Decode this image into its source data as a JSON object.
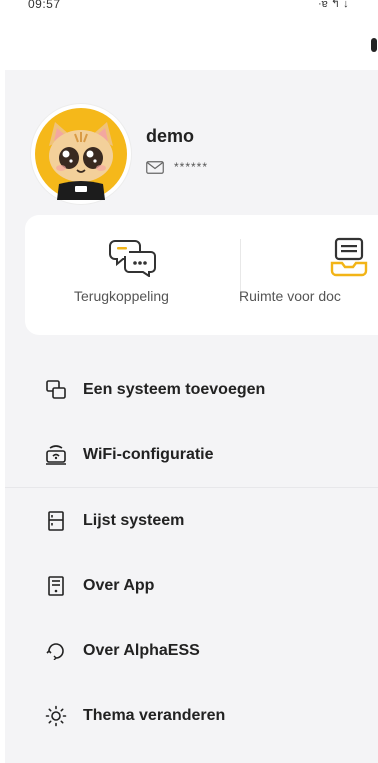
{
  "status_bar": {
    "time": "09:57",
    "icons": "·ɐ ↰ ↓"
  },
  "profile": {
    "username": "demo",
    "email_masked": "******",
    "avatar_icon": "cartoon-cat-avatar-icon",
    "email_icon": "envelope-icon"
  },
  "quick_actions": [
    {
      "label": "Terugkoppeling",
      "icon": "feedback-chat-icon",
      "color": "#f2b417"
    },
    {
      "label": "Ruimte voor doc",
      "icon": "document-tray-icon",
      "color": "#f2b417"
    }
  ],
  "menu": [
    {
      "label": "Een systeem toevoegen",
      "icon": "add-system-icon"
    },
    {
      "label": "WiFi-configuratie",
      "icon": "wifi-router-icon"
    },
    {
      "label": "Lijst systeem",
      "icon": "system-list-icon"
    },
    {
      "label": "Over App",
      "icon": "about-app-icon"
    },
    {
      "label": "Over AlphaESS",
      "icon": "about-company-icon"
    },
    {
      "label": "Thema veranderen",
      "icon": "sun-theme-icon"
    }
  ],
  "colors": {
    "accent": "#f2b417",
    "drawer_bg": "#f4f4f6",
    "card_bg": "#ffffff",
    "text": "#222222"
  }
}
